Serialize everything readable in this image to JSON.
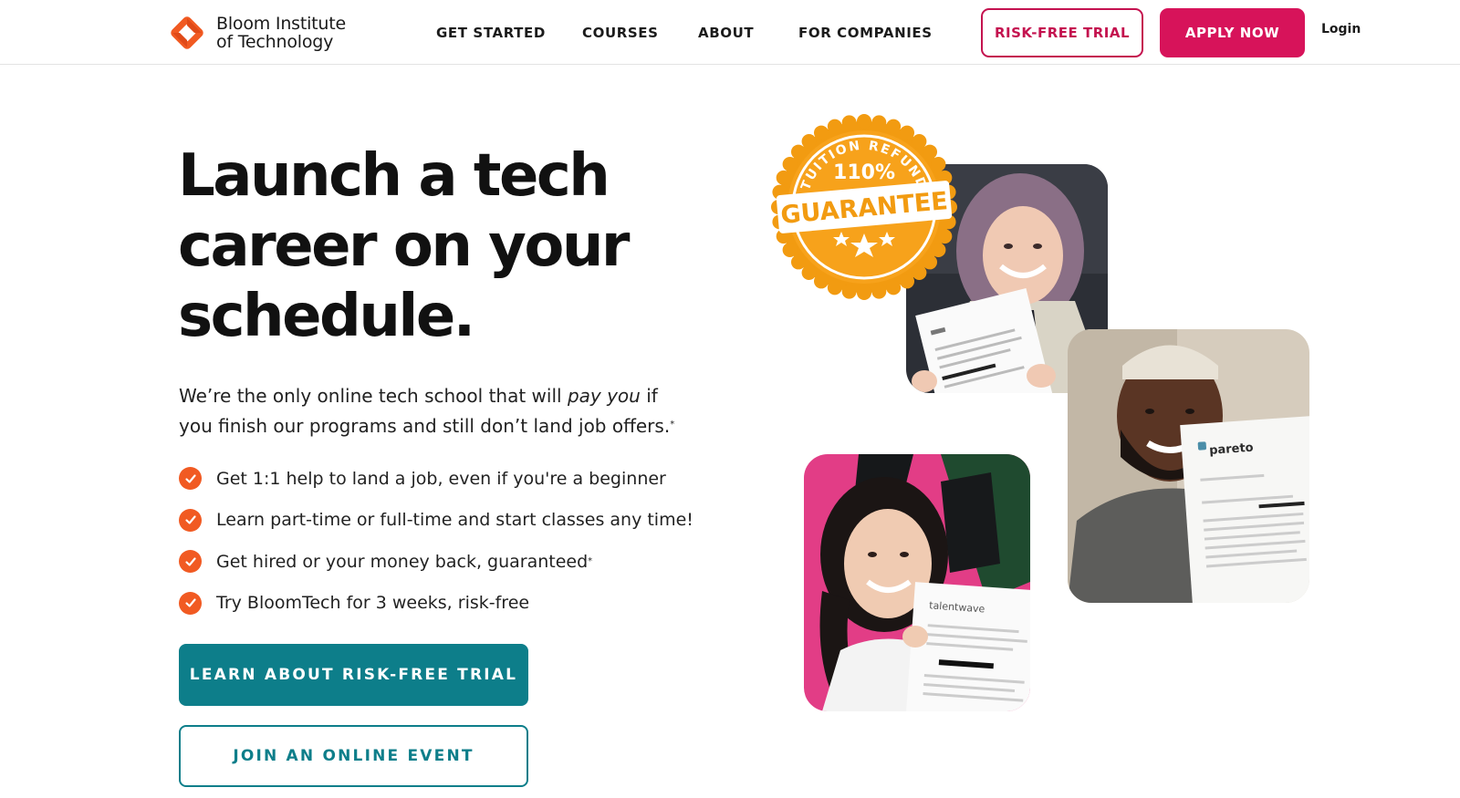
{
  "brand": {
    "name_line1": "Bloom Institute",
    "name_line2": "of Technology",
    "accent_orange": "#f15a22",
    "accent_magenta": "#d7135a",
    "accent_teal": "#0d7e8a"
  },
  "nav": {
    "items": [
      {
        "label": "GET STARTED"
      },
      {
        "label": "COURSES"
      },
      {
        "label": "ABOUT"
      },
      {
        "label": "FOR COMPANIES"
      }
    ],
    "trial_button": "RISK-FREE TRIAL",
    "apply_button": "APPLY NOW",
    "login": "Login"
  },
  "hero": {
    "headline": [
      "Launch a tech",
      "career on your",
      "schedule."
    ],
    "intro_before": "We’re the only online tech school that will ",
    "intro_emphasis": "pay you",
    "intro_after": " if you finish our programs and still don’t land job offers.",
    "intro_mark": "*",
    "features": [
      {
        "text": "Get 1:1 help to land a job, even if you're a beginner",
        "mark": ""
      },
      {
        "text": "Learn part-time or full-time and start classes any time!",
        "mark": ""
      },
      {
        "text": "Get hired or your money back, guaranteed",
        "mark": "*"
      },
      {
        "text": "Try BloomTech for 3 weeks, risk-free",
        "mark": ""
      }
    ],
    "cta_primary": "LEARN ABOUT RISK-FREE TRIAL",
    "cta_secondary": "JOIN AN ONLINE EVENT"
  },
  "badge": {
    "arc_text": "TUITION REFUND",
    "percent": "110%",
    "label": "GUARANTEE"
  },
  "photos": {
    "letter_logos": [
      "pareto",
      "talentwave"
    ]
  }
}
